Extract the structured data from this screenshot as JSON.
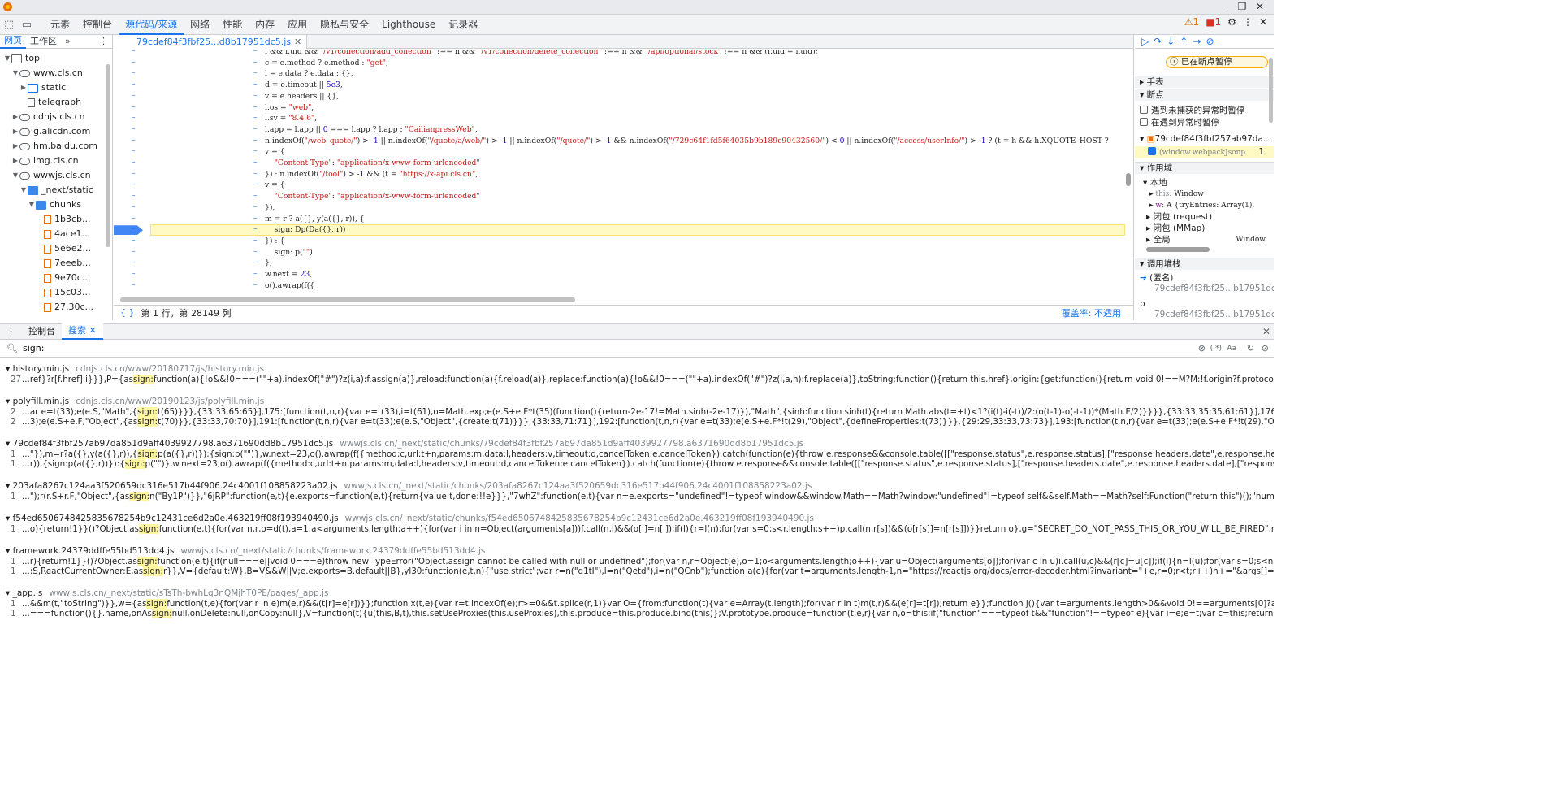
{
  "toolbar": {
    "tabs": [
      "元素",
      "控制台",
      "源代码/来源",
      "网络",
      "性能",
      "内存",
      "应用",
      "隐私与安全",
      "Lighthouse",
      "记录器"
    ],
    "active_tab_index": 2,
    "warnings": "1",
    "errors": "1"
  },
  "navigator": {
    "tabs": [
      "网页",
      "工作区"
    ],
    "more": "»",
    "tree": [
      {
        "label": "top",
        "depth": 0,
        "icon": "frame-icon",
        "expanded": true
      },
      {
        "label": "www.cls.cn",
        "depth": 1,
        "icon": "cloud-icon",
        "expanded": true
      },
      {
        "label": "static",
        "depth": 2,
        "icon": "folder-icon",
        "expanded": false
      },
      {
        "label": "telegraph",
        "depth": 2,
        "icon": "file-icon",
        "expanded": null
      },
      {
        "label": "cdnjs.cls.cn",
        "depth": 1,
        "icon": "cloud-icon",
        "expanded": false
      },
      {
        "label": "g.alicdn.com",
        "depth": 1,
        "icon": "cloud-icon",
        "expanded": false
      },
      {
        "label": "hm.baidu.com",
        "depth": 1,
        "icon": "cloud-icon",
        "expanded": false
      },
      {
        "label": "img.cls.cn",
        "depth": 1,
        "icon": "cloud-icon",
        "expanded": false
      },
      {
        "label": "wwwjs.cls.cn",
        "depth": 1,
        "icon": "cloud-icon",
        "expanded": true
      },
      {
        "label": "_next/static",
        "depth": 2,
        "icon": "folder-icon",
        "expanded": true
      },
      {
        "label": "chunks",
        "depth": 3,
        "icon": "folder-icon",
        "expanded": true
      },
      {
        "label": "1b3cb...",
        "depth": 4,
        "icon": "js-file-icon",
        "expanded": null
      },
      {
        "label": "4ace1...",
        "depth": 4,
        "icon": "js-file-icon",
        "expanded": null
      },
      {
        "label": "5e6e2...",
        "depth": 4,
        "icon": "js-file-icon",
        "expanded": null
      },
      {
        "label": "7eeeb...",
        "depth": 4,
        "icon": "js-file-icon",
        "expanded": null
      },
      {
        "label": "9e70c...",
        "depth": 4,
        "icon": "js-file-icon",
        "expanded": null
      },
      {
        "label": "15c03...",
        "depth": 4,
        "icon": "js-file-icon",
        "expanded": null
      },
      {
        "label": "27.30c...",
        "depth": 4,
        "icon": "js-file-icon",
        "expanded": null
      }
    ]
  },
  "editor": {
    "tab_label": "79cdef84f3fbf25...d8b17951dc5.js",
    "status_position": "第 1 行，第 28149 列",
    "coverage": "覆盖率: 不适用",
    "lines": [
      "i && i.uid && \"/v1/collection/add_collection\" !== n && \"/v1/collection/delete_collection\" !== n && \"/api/optional/stock\" !== n && (r.uid = i.uid);",
      "c = e.method ? e.method : \"get\",",
      "l = e.data ? e.data : {},",
      "d = e.timeout || 5e3,",
      "v = e.headers || {},",
      "l.os = \"web\",",
      "l.sv = \"8.4.6\",",
      "l.app = l.app || 0 === l.app ? l.app : \"CailianpressWeb\",",
      "n.indexOf(\"/web_quote/\") > -1 || n.indexOf(\"/quote/a/web/\") > -1 || n.indexOf(\"/quote/\") > -1 && n.indexOf(\"/729c64f1fd5f64035b9b189c90432560/\") < 0 || n.indexOf(\"/access/userInfo/\") > -1 ? (t = h && h.XQUOTE_HOST ?",
      "v = {",
      "    \"Content-Type\": \"application/x-www-form-urlencoded\"",
      "}) : n.indexOf(\"/tool\") > -1 && (t = \"https://x-api.cls.cn\",",
      "v = {",
      "    \"Content-Type\": \"application/x-www-form-urlencoded\"",
      "}),",
      "m = r ? a({}, y(a({}, r)), {",
      "    sign: Dp(Da({}, r))",
      "}) : {",
      "    sign: p(\"\")",
      "},",
      "w.next = 23,",
      "o().awrap(f({"
    ],
    "highlight_line_index": 16
  },
  "debugger": {
    "paused_label": "已在断点暂停",
    "sections": {
      "watch": "手表",
      "breakpoints": "断点",
      "scope": "作用域",
      "call_stack": "调用堆栈"
    },
    "pause_uncaught": "遇到未捕获的异常时暂停",
    "pause_caught": "在遇到异常时暂停",
    "bp_file": "79cdef84f3fbf257ab97da...",
    "bp_code": "(window.webpackJsonp",
    "bp_line": "1",
    "scope_local": "本地",
    "scope_this_key": "this:",
    "scope_this_val": "Window",
    "scope_w_key": "w:",
    "scope_w_val": "A  {tryEntries: Array(1),",
    "closure_request": "闭包 (request)",
    "closure_mmap": "闭包 (MMap)",
    "global_key": "全局",
    "global_val": "Window",
    "stack": [
      {
        "name": "(匿名)",
        "loc": "79cdef84f3fbf25...b17951dc5.",
        "current": true
      },
      {
        "name": "p",
        "loc": "79cdef84f3fbf25...b17951dc5.",
        "current": false
      }
    ]
  },
  "drawer": {
    "tabs": [
      "控制台",
      "搜索"
    ],
    "active_tab_index": 1,
    "query": "sign:",
    "regex_label": "(.*)",
    "case_label": "Aa",
    "results": [
      {
        "file": "history.min.js",
        "path": "cdnjs.cls.cn/www/20180717/js/history.min.js",
        "lines": [
          {
            "num": "27",
            "before": "...ref}?r[f.href]:i}}},P={as",
            "match": "sign:",
            "after": "function(a){!o&&!0===(\"\"+a).indexOf(\"#\")?z(i,a):f.assign(a)},reload:function(a){f.reload(a)},replace:function(a){!o&&!0===(\"\"+a).indexOf(\"#\")?z(i,a,h):f.replace(a)},toString:function(){return this.href},origin:{get:function(){return void 0!==M?M:!f.origin?f.protocol+\"//\"+f.hostname+(f.port?\":\"+f.port:\"\"):f.ori..."
          }
        ]
      },
      {
        "file": "polyfill.min.js",
        "path": "cdnjs.cls.cn/www/20190123/js/polyfill.min.js",
        "lines": [
          {
            "num": "2",
            "before": "...ar e=t(33);e(e.S,\"Math\",{",
            "match": "sign:",
            "after": "t(65)}}},{33:33,65:65}],175:[function(t,n,r){var e=t(33),i=t(61),o=Math.exp;e(e.S+e.F*t(35)(function(){return-2e-17!=Math.sinh(-2e-17)}),\"Math\",{sinh:function sinh(t){return Math.abs(t=+t)<1?(i(t)-i(-t))/2:(o(t-1)-o(-t-1))*(Math.E/2)}}}},{33:33,35:35,61:61}],176:[function(t,n,r){var e=t(33),i=t(61),o=Math.ex..."
          },
          {
            "num": "2",
            "before": "...3);e(e.S+e.F,\"Object\",{as",
            "match": "sign:",
            "after": "t(70)}},{33:33,70:70}],191:[function(t,n,r){var e=t(33);e(e.S,\"Object\",{create:t(71)}}},{33:33,71:71}],192:[function(t,n,r){var e=t(33);e(e.S+e.F*!t(29),\"Object\",{defineProperties:t(73)}}},{29:29,33:33,73:73}],193:[function(t,n,r){var e=t(33);e(e.S+e.F*!t(29),\"Object\",{defineProperty:t(72).f}}},{29:29,33:33,72:72}],19..."
          }
        ]
      },
      {
        "file": "79cdef84f3fbf257ab97da851d9aff4039927798.a6371690dd8b17951dc5.js",
        "path": "wwwjs.cls.cn/_next/static/chunks/79cdef84f3fbf257ab97da851d9aff4039927798.a6371690dd8b17951dc5.js",
        "lines": [
          {
            "num": "1",
            "before": "...\"}),m=r?a({},y(a({},r)),{",
            "match": "sign:",
            "after": "p(a({},r))}):{sign:p(\"\")},w.next=23,o().awrap(f({method:c,url:t+n,params:m,data:l,headers:v,timeout:d,cancelToken:e.cancelToken}).catch(function(e){throw e.response&&console.table([[\"response.status\",e.response.status],[\"response.headers.date\",e.response.headers.date],[\"response.header.content-securi..."
          },
          {
            "num": "1",
            "before": "...r)),{sign:p(a({},r))}):{",
            "match": "sign:",
            "after": "p(\"\")},w.next=23,o().awrap(f({method:c,url:t+n,params:m,data:l,headers:v,timeout:d,cancelToken:e.cancelToken}).catch(function(e){throw e.response&&console.table([[\"response.status\",e.response.status],[\"response.headers.date\",e.response.headers.date],[\"response.header.content-security-policy\",e.resp..."
          }
        ]
      },
      {
        "file": "203afa8267c124aa3f520659dc316e517b44f906.24c4001f108858223a02.js",
        "path": "wwwjs.cls.cn/_next/static/chunks/203afa8267c124aa3f520659dc316e517b44f906.24c4001f108858223a02.js",
        "lines": [
          {
            "num": "1",
            "before": "...\");r(r.S+r.F,\"Object\",{as",
            "match": "sign:",
            "after": "n(\"By1P\")}},\"6jRP\":function(e,t){e.exports=function(e,t){return{value:t,done:!!e}}},\"7whZ\":function(e,t){var n=e.exports=\"undefined\"!=typeof window&&window.Math==Math?window:\"undefined\"!=typeof self&&self.Math==Math?self:Function(\"return this\")();\"number\"==typeof __g&&(__g=n)},A9a0:f..."
          }
        ]
      },
      {
        "file": "f54ed65067484258356782​54b9c12431ce6d2a0e.463219ff08f193940490.js",
        "path": "wwwjs.cls.cn/_next/static/chunks/f54ed6506748425835678254b9c12431ce6d2a0e.463219ff08f193940490.js",
        "lines": [
          {
            "num": "1",
            "before": "...o){return!1}}()?Object.as",
            "match": "sign:",
            "after": "function(e,t){for(var n,r,o=d(t),a=1;a<arguments.length;a++){for(var i in n=Object(arguments[a]))f.call(n,i)&&(o[i]=n[i]);if(l){r=l(n);for(var s=0;s<r.length;s++)p.call(n,r[s])&&(o[r[s]]=n[r[s]])}}return o},g=\"SECRET_DO_NOT_PASS_THIS_OR_YOU_WILL_BE_FIRED\",m=s,y=c,v=g,b={},w=function(e,n,r,o){for..."
          }
        ]
      },
      {
        "file": "framework.24379ddffe55bd513dd4.js",
        "path": "wwwjs.cls.cn/_next/static/chunks/framework.24379ddffe55bd513dd4.js",
        "lines": [
          {
            "num": "1",
            "before": "...r){return!1}}()?Object.as",
            "match": "sign:",
            "after": "function(e,t){if(null===e||void 0===e)throw new TypeError(\"Object.assign cannot be called with null or undefined\");for(var n,r=Object(e),o=1;o<arguments.length;o++){var u=Object(arguments[o]);for(var c in u)i.call(u,c)&&(r[c]=u[c]);if(l){n=l(u);for(var s=0;s<n.length;s++)a.call(u,n[s])&&(r[n[s]]=u[n[..."
          },
          {
            "num": "1",
            "before": "...:S,ReactCurrentOwner:E,as",
            "match": "sign:",
            "after": "r}},V={default:W},B=V&&W||V;e.exports=B.default||B},yl30:function(e,t,n){\"use strict\";var r=n(\"q1tI\"),l=n(\"Qetd\"),i=n(\"QCnb\");function a(e){for(var t=arguments.length-1,n=\"https://reactjs.org/docs/error-decoder.html?invariant=\"+e,r=0;r<t;r++)n+=\"&args[]=\"+encodeURIComponent(arguments[r..."
          }
        ]
      },
      {
        "file": "_app.js",
        "path": "wwwjs.cls.cn/_next/static/sTsTh-bwhLq3nQMjhT0PE/pages/_app.js",
        "lines": [
          {
            "num": "1",
            "before": "...&&m(t,\"toString\")}},w={as",
            "match": "sign:",
            "after": "function(t,e){for(var r in e)m(e,r)&&(t[r]=e[r])}};function x(t,e){var r=t.indexOf(e);r>=0&&t.splice(r,1)}var O={from:function(t){var e=Array(t.length);for(var r in t)m(t,r)&&(e[r]=t[r]);return e}};function j(){var t=arguments.length>0&&void 0!==arguments[0]?arguments[0]:{},e=n({},t),r=new Promise((fu..."
          },
          {
            "num": "1",
            "before": "...===function(){}.name,onAs",
            "match": "sign:",
            "after": "null,onDelete:null,onCopy:null},V=function(t){u(this,B,t),this.setUseProxies(this.useProxies),this.produce=this.produce.bind(this)};V.prototype.produce=function(t,e,r){var n,o=this;if(\"function\"===typeof t&&\"function\"!==typeof e){var i=e;e=t;var c=this;return function(t){for(var r=this;void 0===t&&(t=..."
          }
        ]
      }
    ]
  }
}
